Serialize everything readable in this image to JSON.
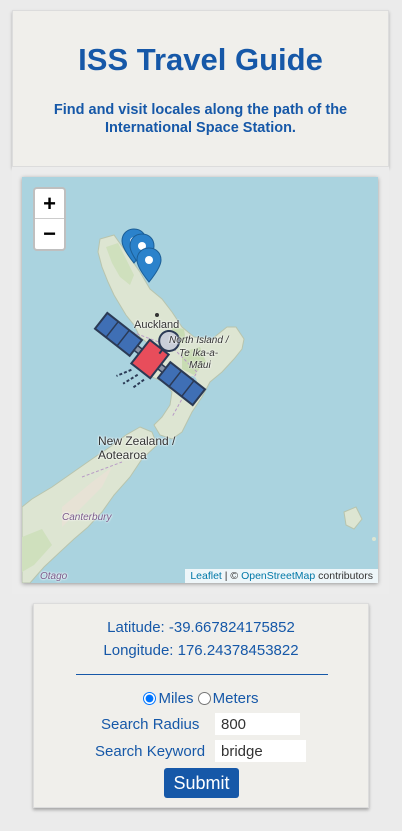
{
  "header": {
    "title": "ISS Travel Guide",
    "subtitle": "Find and visit locales along the path of the International Space Station."
  },
  "map": {
    "zoom_in": "+",
    "zoom_out": "−",
    "labels": {
      "auckland": "Auckland",
      "north_island_1": "North Island /",
      "north_island_2": "Te Ika-a-",
      "north_island_3": "Māui",
      "nz_1": "New Zealand /",
      "nz_2": "Aotearoa",
      "canterbury": "Canterbury",
      "otago": "Otago"
    },
    "attribution": {
      "leaflet": "Leaflet",
      "separator": " | © ",
      "osm": "OpenStreetMap",
      "contributors": " contributors"
    },
    "marker_color": "#2b82cb",
    "water_color": "#aad3df",
    "land_color": "#dfe6d3"
  },
  "panel": {
    "latitude": "Latitude: -39.667824175852",
    "longitude": "Longitude: 176.24378453822",
    "units": {
      "miles": "Miles",
      "meters": "Meters",
      "selected": "Miles"
    },
    "radius_label": "Search Radius",
    "radius_value": "800",
    "keyword_label": "Search Keyword",
    "keyword_value": "bridge",
    "submit_label": "Submit"
  },
  "colors": {
    "accent": "#1658a8"
  }
}
